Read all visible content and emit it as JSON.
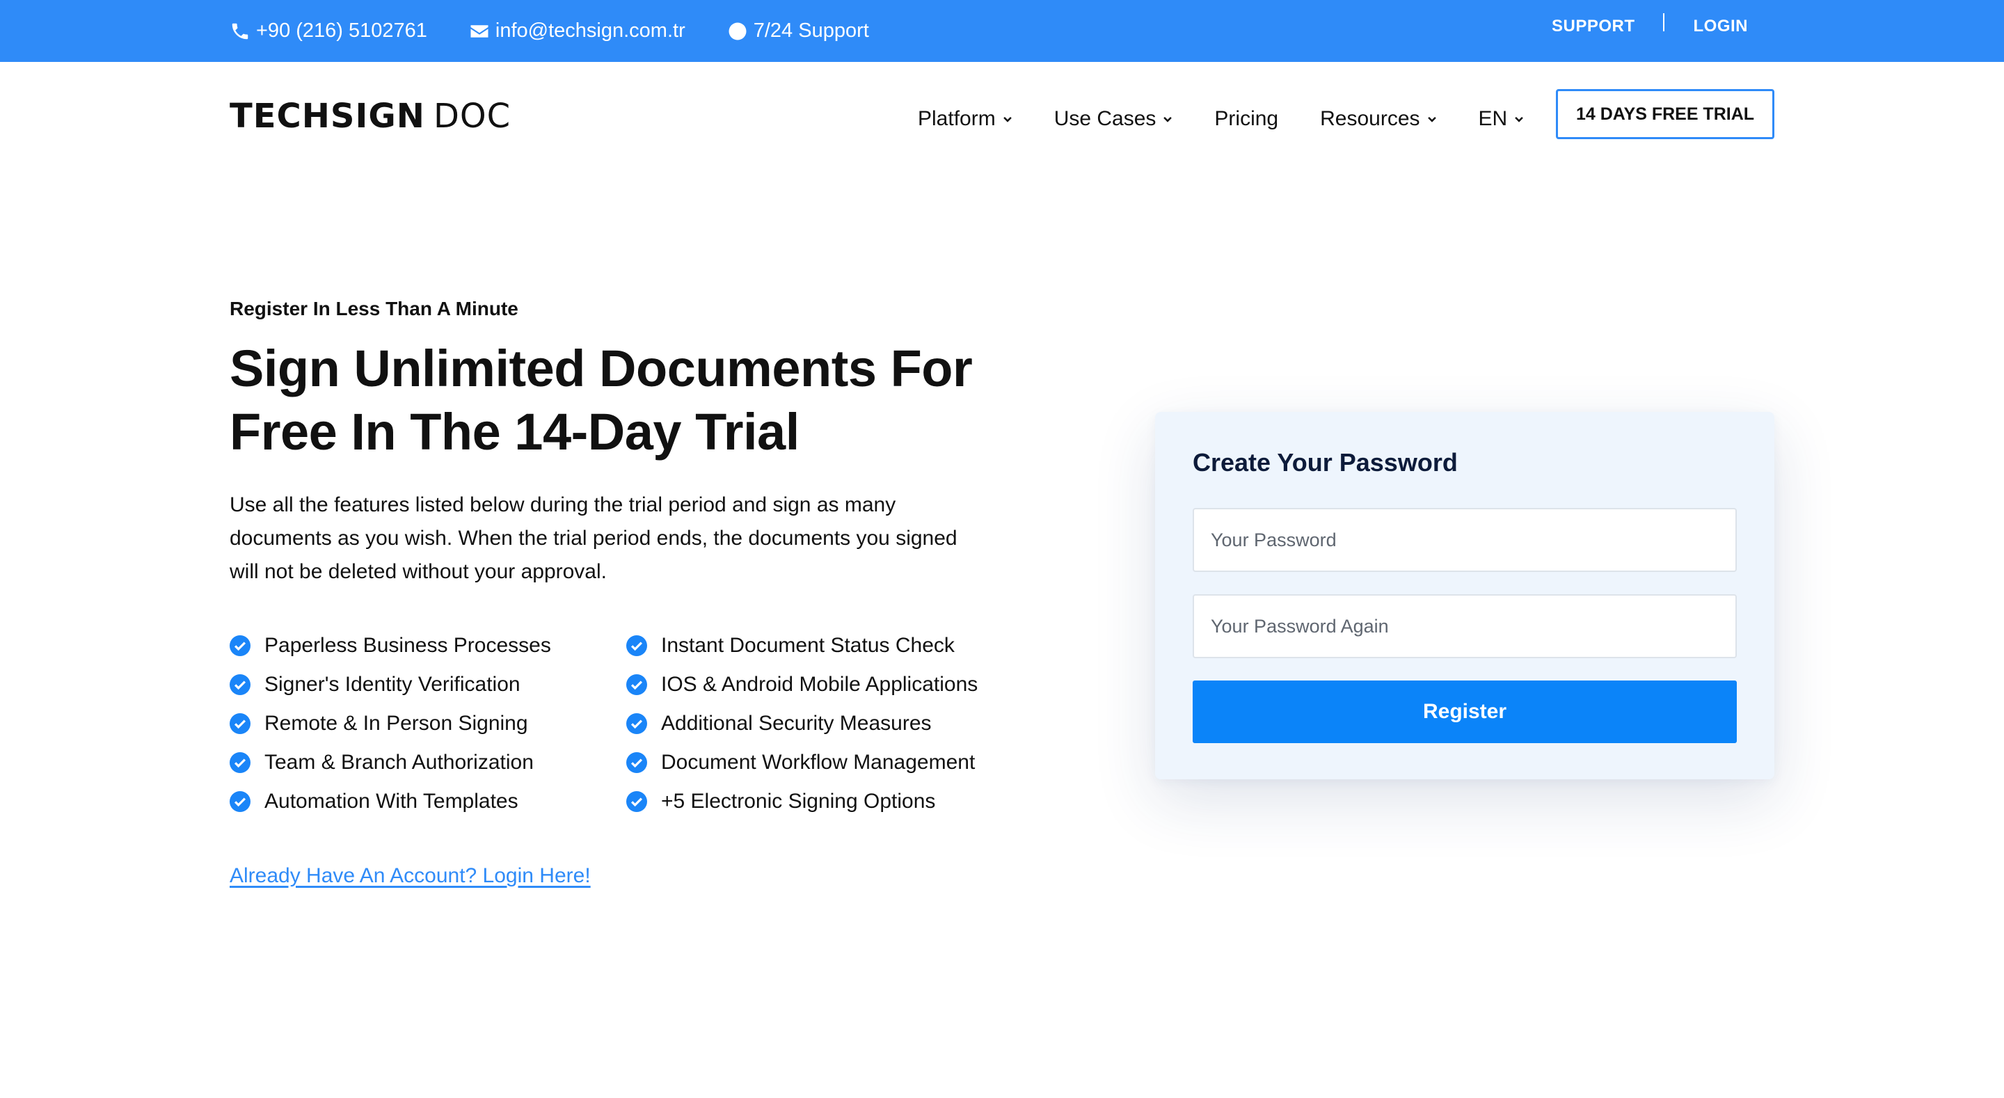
{
  "topbar": {
    "phone": "+90 (216) 5102761",
    "email": "info@techsign.com.tr",
    "support_hours": "7/24 Support",
    "support_link": "SUPPORT",
    "login_link": "LOGIN",
    "icons": {
      "phone": "phone-icon",
      "email": "envelope-icon",
      "support": "clock-icon"
    },
    "bg_color": "#2f8bf8"
  },
  "header": {
    "logo_bold": "TECHSIGN",
    "logo_light": "DOC",
    "nav": [
      {
        "label": "Platform",
        "dropdown": true
      },
      {
        "label": "Use Cases",
        "dropdown": true
      },
      {
        "label": "Pricing",
        "dropdown": false
      },
      {
        "label": "Resources",
        "dropdown": true
      },
      {
        "label": "EN",
        "dropdown": true
      }
    ],
    "trial_button": "14 DAYS FREE TRIAL"
  },
  "hero": {
    "eyebrow": "Register In Less Than A Minute",
    "headline_line1": "Sign Unlimited Documents For",
    "headline_line2": "Free In The 14-Day Trial",
    "lead": "Use all the features listed below during the trial period and sign as many documents as you wish. When the trial period ends, the documents you signed will not be deleted without your approval.",
    "features": [
      "Paperless Business Processes",
      "Instant Document Status Check",
      "Signer's Identity Verification",
      "IOS & Android Mobile Applications",
      "Remote & In Person Signing",
      "Additional Security Measures",
      "Team & Branch Authorization",
      "Document Workflow Management",
      "Automation With Templates",
      "+5 Electronic Signing Options"
    ],
    "login_link": "Already Have An Account? Login Here!"
  },
  "form": {
    "title": "Create Your Password",
    "password_placeholder": "Your Password",
    "password_again_placeholder": "Your Password Again",
    "password_value": "",
    "password_again_value": "",
    "submit_label": "Register",
    "accent_color": "#0b84f9"
  }
}
